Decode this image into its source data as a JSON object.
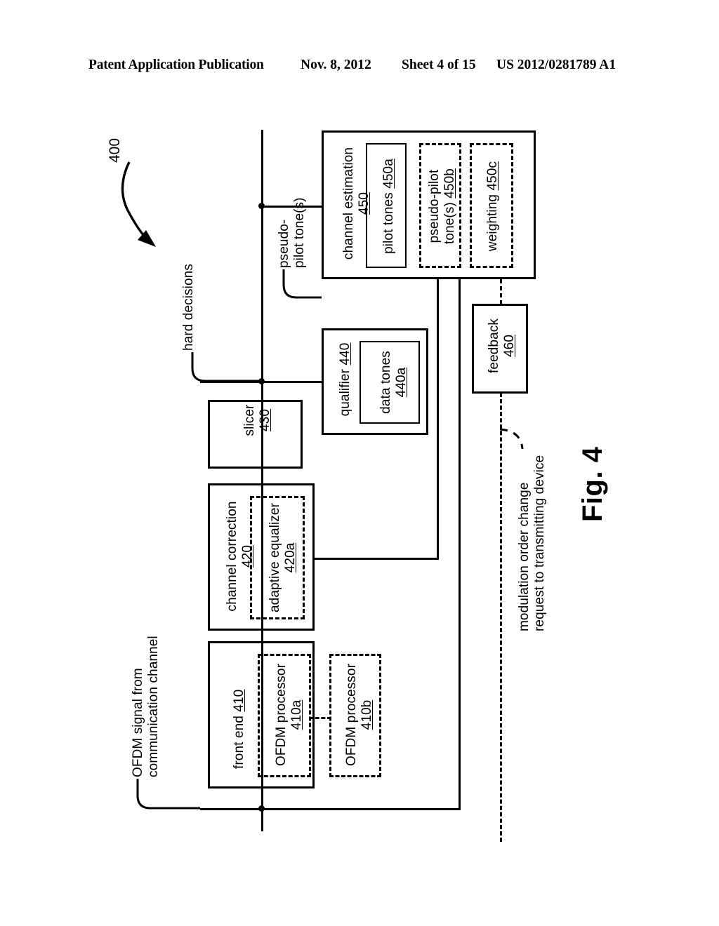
{
  "header": {
    "publication": "Patent Application Publication",
    "date": "Nov. 8, 2012",
    "sheet": "Sheet 4 of 15",
    "patent_number": "US 2012/0281789 A1"
  },
  "figure": {
    "caption": "Fig. 4",
    "reference_numeral": "400"
  },
  "blocks": {
    "front_end": {
      "label": "front end 410",
      "label_text": "front end ",
      "ref": "410",
      "children": [
        {
          "label_text": "OFDM processor",
          "ref": "410a",
          "style": "dashed"
        }
      ]
    },
    "ofdm_processor_b": {
      "label_text": "OFDM processor",
      "ref": "410b",
      "style": "dashed"
    },
    "channel_correction": {
      "label_text": "channel correction",
      "ref": "420",
      "children": [
        {
          "label_text": "adaptive equalizer",
          "ref": "420a",
          "style": "dashed"
        }
      ]
    },
    "slicer": {
      "label_text": "slicer",
      "ref": "430"
    },
    "qualifier": {
      "label_text": "qualifier ",
      "ref": "440",
      "children": [
        {
          "label_text": "data tones",
          "ref": "440a",
          "style": "solid"
        }
      ]
    },
    "channel_estimation": {
      "label_text": "channel estimation",
      "ref": "450",
      "children": [
        {
          "label_text": "pilot tones ",
          "ref": "450a",
          "style": "solid"
        },
        {
          "label_text_line1": "pseudo-pilot",
          "label_text_line2": "tone(s) ",
          "ref": "450b",
          "style": "dashed"
        },
        {
          "label_text": "weighting ",
          "ref": "450c",
          "style": "dashed"
        }
      ]
    },
    "feedback": {
      "label_text": "feedback",
      "ref": "460"
    }
  },
  "callouts": {
    "input_signal": {
      "line1": "OFDM signal from",
      "line2": "communication channel"
    },
    "hard_decisions": {
      "line1": "hard decisions"
    },
    "pseudo_pilot": {
      "line1": "pseudo-",
      "line2": "pilot tone(s)"
    },
    "modulation_request": {
      "line1": "modulation order change",
      "line2": "request to transmitting device"
    }
  },
  "colors": {
    "ink": "#000000",
    "paper": "#ffffff"
  }
}
